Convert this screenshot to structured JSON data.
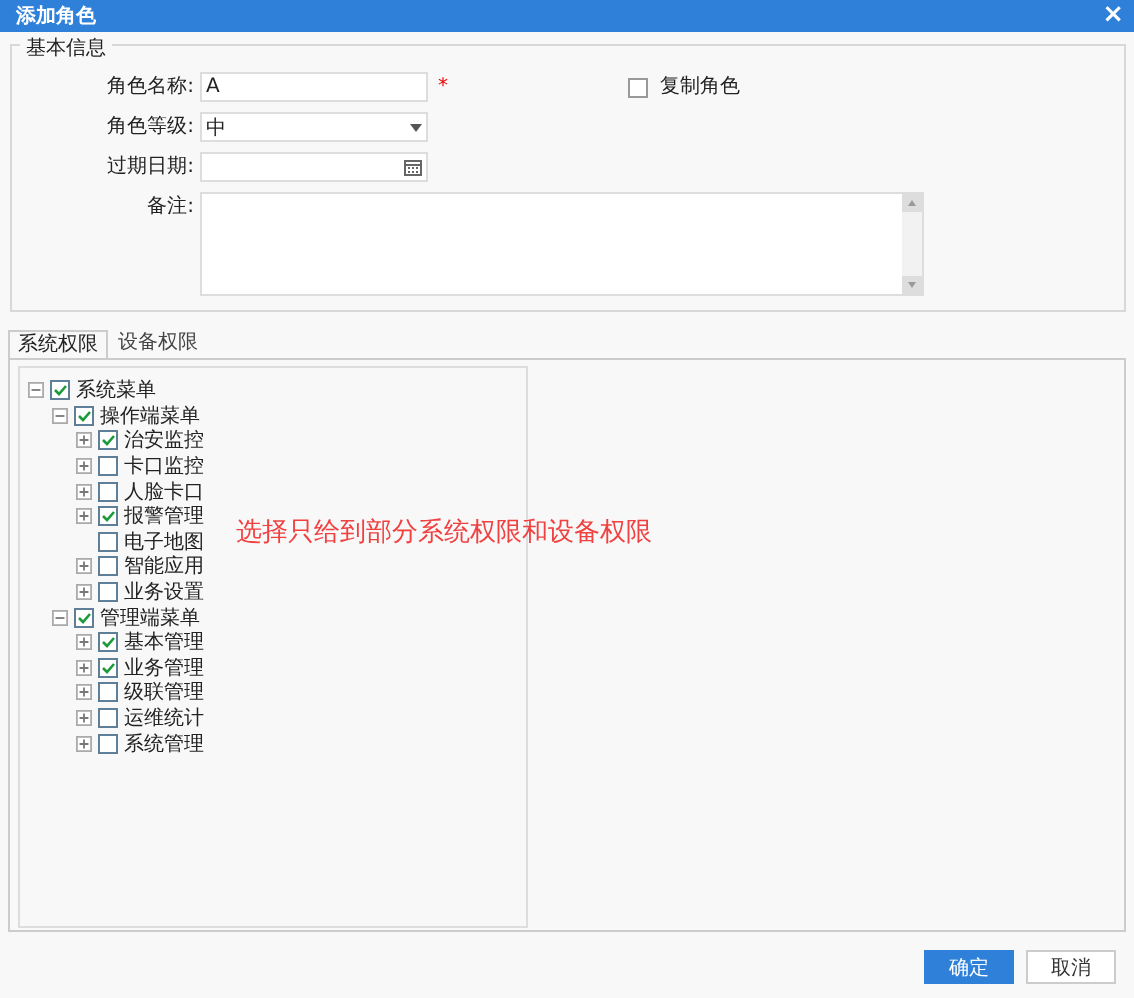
{
  "window": {
    "title": "添加角色",
    "close": "×"
  },
  "basic_info": {
    "legend": "基本信息",
    "fields": [
      {
        "kind": "text",
        "label": "角色名称:",
        "value": "A",
        "required": "*"
      },
      {
        "kind": "select",
        "label": "角色等级:",
        "value": "中"
      },
      {
        "kind": "date",
        "label": "过期日期:"
      },
      {
        "kind": "textarea",
        "label": "备注:"
      }
    ],
    "copy_role": {
      "label": "复制角色",
      "checked": false
    }
  },
  "tabs": [
    {
      "label": "系统权限",
      "selected": true
    },
    {
      "label": "设备权限",
      "selected": false
    }
  ],
  "tree": [
    {
      "label": "系统菜单",
      "kind": "branch",
      "expanded": true,
      "checked": true,
      "children": [
        {
          "label": "操作端菜单",
          "kind": "branch",
          "expanded": true,
          "checked": true,
          "children": [
            {
              "label": "治安监控",
              "kind": "branch",
              "expanded": false,
              "checked": true
            },
            {
              "label": "卡口监控",
              "kind": "branch",
              "expanded": false,
              "checked": false
            },
            {
              "label": "人脸卡口",
              "kind": "branch",
              "expanded": false,
              "checked": false
            },
            {
              "label": "报警管理",
              "kind": "branch",
              "expanded": false,
              "checked": true
            },
            {
              "label": "电子地图",
              "kind": "leaf",
              "checked": false
            },
            {
              "label": "智能应用",
              "kind": "branch",
              "expanded": false,
              "checked": false
            },
            {
              "label": "业务设置",
              "kind": "branch",
              "expanded": false,
              "checked": false
            }
          ]
        },
        {
          "label": "管理端菜单",
          "kind": "branch",
          "expanded": true,
          "checked": true,
          "children": [
            {
              "label": "基本管理",
              "kind": "branch",
              "expanded": false,
              "checked": true
            },
            {
              "label": "业务管理",
              "kind": "branch",
              "expanded": false,
              "checked": true
            },
            {
              "label": "级联管理",
              "kind": "branch",
              "expanded": false,
              "checked": false
            },
            {
              "label": "运维统计",
              "kind": "branch",
              "expanded": false,
              "checked": false
            },
            {
              "label": "系统管理",
              "kind": "branch",
              "expanded": false,
              "checked": false
            }
          ]
        }
      ]
    }
  ],
  "annotation": "选择只给到部分系统权限和设备权限",
  "buttons": [
    {
      "label": "确定",
      "kind": "primary"
    },
    {
      "label": "取消",
      "kind": "secondary"
    }
  ]
}
